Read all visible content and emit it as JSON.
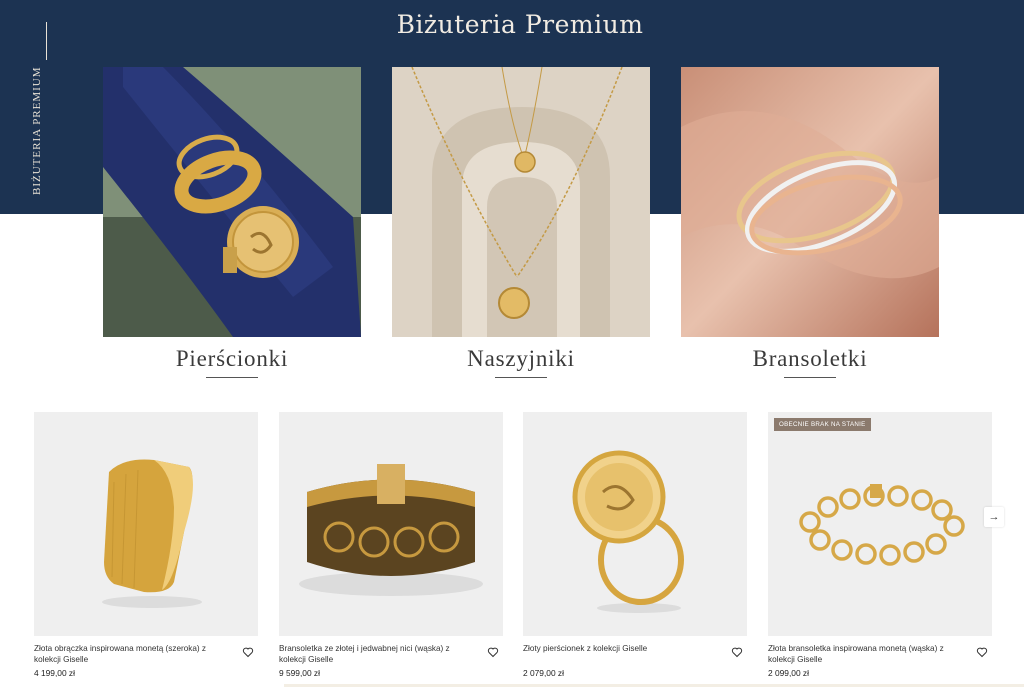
{
  "hero": {
    "title": "Biżuteria Premium",
    "side_label": "BIŻUTERIA PREMIUM",
    "background": "#1c3352"
  },
  "categories": [
    {
      "label": "Pierścionki",
      "image": "rings-on-navy-fabric"
    },
    {
      "label": "Naszyjniki",
      "image": "necklaces-on-arches"
    },
    {
      "label": "Bransoletki",
      "image": "bangles-on-silk"
    }
  ],
  "products": [
    {
      "name": "Złota obrączka inspirowana monetą (szeroka) z kolekcji Giselle",
      "price": "4 199,00 zł",
      "badge": ""
    },
    {
      "name": "Bransoletka ze złotej i jedwabnej nici (wąska) z kolekcji Giselle",
      "price": "9 599,00 zł",
      "badge": ""
    },
    {
      "name": "Złoty pierścionek z kolekcji Giselle",
      "price": "2 079,00 zł",
      "badge": ""
    },
    {
      "name": "Złota bransoletka inspirowana monetą (wąska) z kolekcji Giselle",
      "price": "2 099,00 zł",
      "badge": "OBECNIE BRAK NA STANIE"
    }
  ],
  "carousel": {
    "prev_icon": "arrow-left-icon",
    "next_icon": "arrow-right-icon",
    "prev_glyph": "←",
    "next_glyph": "→"
  },
  "colors": {
    "navy": "#1c3352",
    "gold": "#d4a640",
    "badge": "#8b7a6d",
    "card_bg": "#efefef"
  }
}
